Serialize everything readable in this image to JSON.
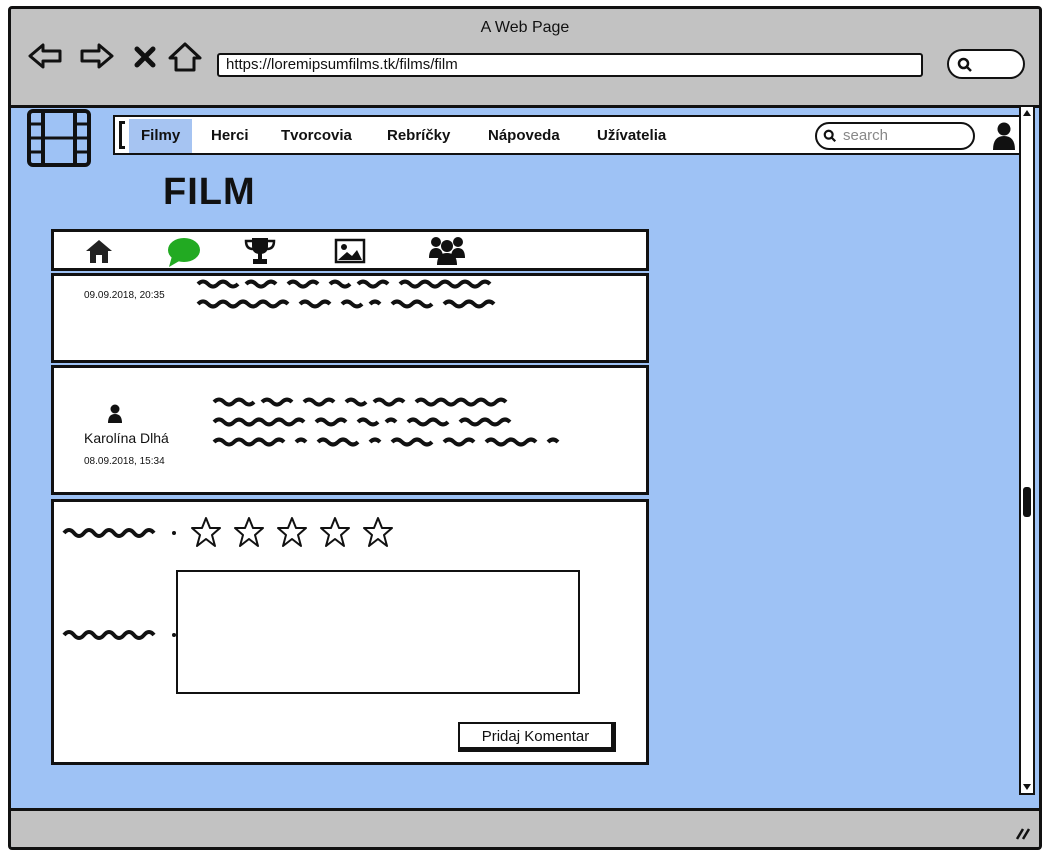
{
  "window": {
    "title": "A Web Page"
  },
  "browser": {
    "url": "https://loremipsumfilms.tk/films/film",
    "icons": [
      "back-arrow-icon",
      "forward-arrow-icon",
      "stop-x-icon",
      "home-icon",
      "search-icon"
    ]
  },
  "nav": {
    "items": [
      {
        "label": "Filmy",
        "active": true
      },
      {
        "label": "Herci",
        "active": false
      },
      {
        "label": "Tvorcovia",
        "active": false
      },
      {
        "label": "Rebríčky",
        "active": false
      },
      {
        "label": "Nápoveda",
        "active": false
      },
      {
        "label": "Užívatelia",
        "active": false
      }
    ],
    "search_placeholder": "search",
    "icons": [
      "film-logo-icon",
      "user-icon",
      "search-icon"
    ]
  },
  "page": {
    "title": "FILM"
  },
  "tabs": [
    {
      "icon": "home-icon",
      "active": false
    },
    {
      "icon": "comment-icon",
      "active": true,
      "color": "#22aa22"
    },
    {
      "icon": "trophy-icon",
      "active": false
    },
    {
      "icon": "image-icon",
      "active": false
    },
    {
      "icon": "group-icon",
      "active": false
    }
  ],
  "comments": [
    {
      "author": "",
      "date": "09.09.2018, 20:35"
    },
    {
      "author": "Karolína Dlhá",
      "date": "08.09.2018, 15:34"
    }
  ],
  "form": {
    "stars": 5,
    "rating_value": 0,
    "submit_label": "Pridaj Komentar"
  },
  "colors": {
    "background": "#9ec2f5",
    "chrome": "#c2c2c2",
    "active_tab": "#a6c4f2",
    "comment_icon": "#22aa22"
  }
}
